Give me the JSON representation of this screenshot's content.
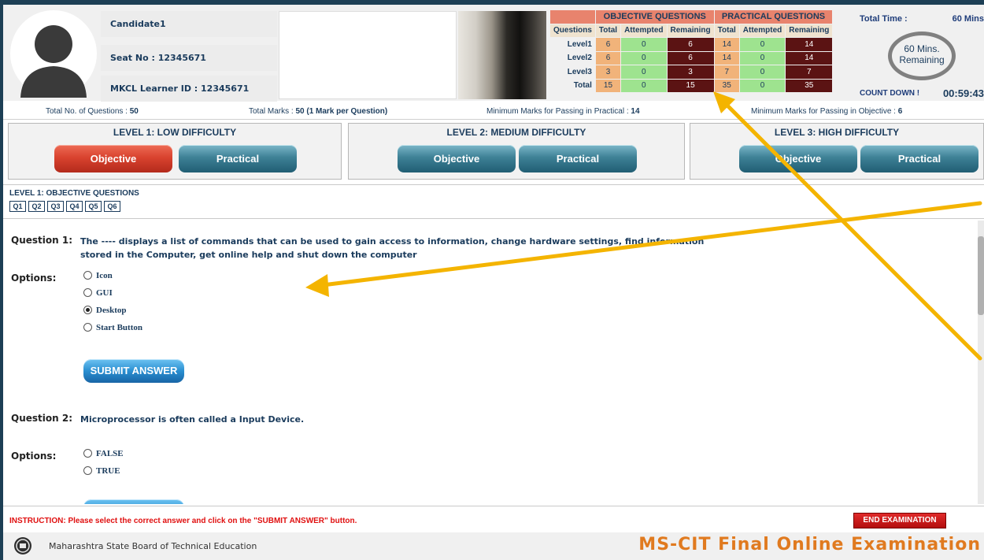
{
  "candidate": {
    "name": "Candidate1",
    "seat_no": "Seat No : 12345671",
    "learner_id": "MKCL Learner ID : 12345671"
  },
  "summary_table": {
    "objective_header": "OBJECTIVE QUESTIONS",
    "practical_header": "PRACTICAL QUESTIONS",
    "columns": [
      "Questions",
      "Total",
      "Attempted",
      "Remaining",
      "Total",
      "Attempted",
      "Remaining"
    ],
    "rows": [
      {
        "label": "Level1",
        "obj_total": "6",
        "obj_attempted": "0",
        "obj_remaining": "6",
        "prac_total": "14",
        "prac_attempted": "0",
        "prac_remaining": "14"
      },
      {
        "label": "Level2",
        "obj_total": "6",
        "obj_attempted": "0",
        "obj_remaining": "6",
        "prac_total": "14",
        "prac_attempted": "0",
        "prac_remaining": "14"
      },
      {
        "label": "Level3",
        "obj_total": "3",
        "obj_attempted": "0",
        "obj_remaining": "3",
        "prac_total": "7",
        "prac_attempted": "0",
        "prac_remaining": "7"
      },
      {
        "label": "Total",
        "obj_total": "15",
        "obj_attempted": "0",
        "obj_remaining": "15",
        "prac_total": "35",
        "prac_attempted": "0",
        "prac_remaining": "35"
      }
    ]
  },
  "timer": {
    "total_time_label": "Total Time :",
    "total_time_value": "60 Mins",
    "ring_line1": "60 Mins.",
    "ring_line2": "Remaining",
    "countdown_label": "COUNT DOWN !",
    "countdown_value": "00:59:43"
  },
  "marks_strip": {
    "total_questions_label": "Total No. of Questions :",
    "total_questions_value": "50",
    "total_marks_label": "Total Marks :",
    "total_marks_value": "50",
    "total_marks_note": "(1 Mark per Question)",
    "min_practical_label": "Minimum Marks for Passing in Practical :",
    "min_practical_value": "14",
    "min_objective_label": "Minimum Marks for Passing in Objective :",
    "min_objective_value": "6"
  },
  "levels": [
    {
      "title": "LEVEL 1: LOW DIFFICULTY",
      "objective_label": "Objective",
      "practical_label": "Practical"
    },
    {
      "title": "LEVEL 2: MEDIUM DIFFICULTY",
      "objective_label": "Objective",
      "practical_label": "Practical"
    },
    {
      "title": "LEVEL 3: HIGH DIFFICULTY",
      "objective_label": "Objective",
      "practical_label": "Practical"
    }
  ],
  "question_nav": {
    "title": "LEVEL 1:  OBJECTIVE QUESTIONS",
    "buttons": [
      "Q1",
      "Q2",
      "Q3",
      "Q4",
      "Q5",
      "Q6"
    ]
  },
  "questions": [
    {
      "label": "Question 1:",
      "text": "The ---- displays a list of commands that can be used to gain access to information, change hardware settings, find information stored in the Computer, get online help and shut down the computer",
      "options_label": "Options:",
      "options": [
        "Icon",
        "GUI",
        "Desktop",
        "Start Button"
      ],
      "selected": "Desktop",
      "submit_label": "SUBMIT ANSWER"
    },
    {
      "label": "Question 2:",
      "text": "Microprocessor is often called a Input Device.",
      "options_label": "Options:",
      "options": [
        "FALSE",
        "TRUE"
      ],
      "selected": ""
    }
  ],
  "footer": {
    "instruction": "INSTRUCTION:  Please select the correct answer and click on the \"SUBMIT ANSWER\" button.",
    "end_button": "END EXAMINATION",
    "board": "Maharashtra State Board of Technical Education",
    "exam_title": "MS-CIT Final Online Examination"
  },
  "colors": {
    "active_tab": "#d9432f",
    "tab": "#3e8196",
    "remaining_cell": "#5b1313",
    "attempted_cell": "#9ee38f",
    "total_cell": "#f1b37a",
    "title_orange": "#e07a1f",
    "arrow": "#f4b400"
  }
}
